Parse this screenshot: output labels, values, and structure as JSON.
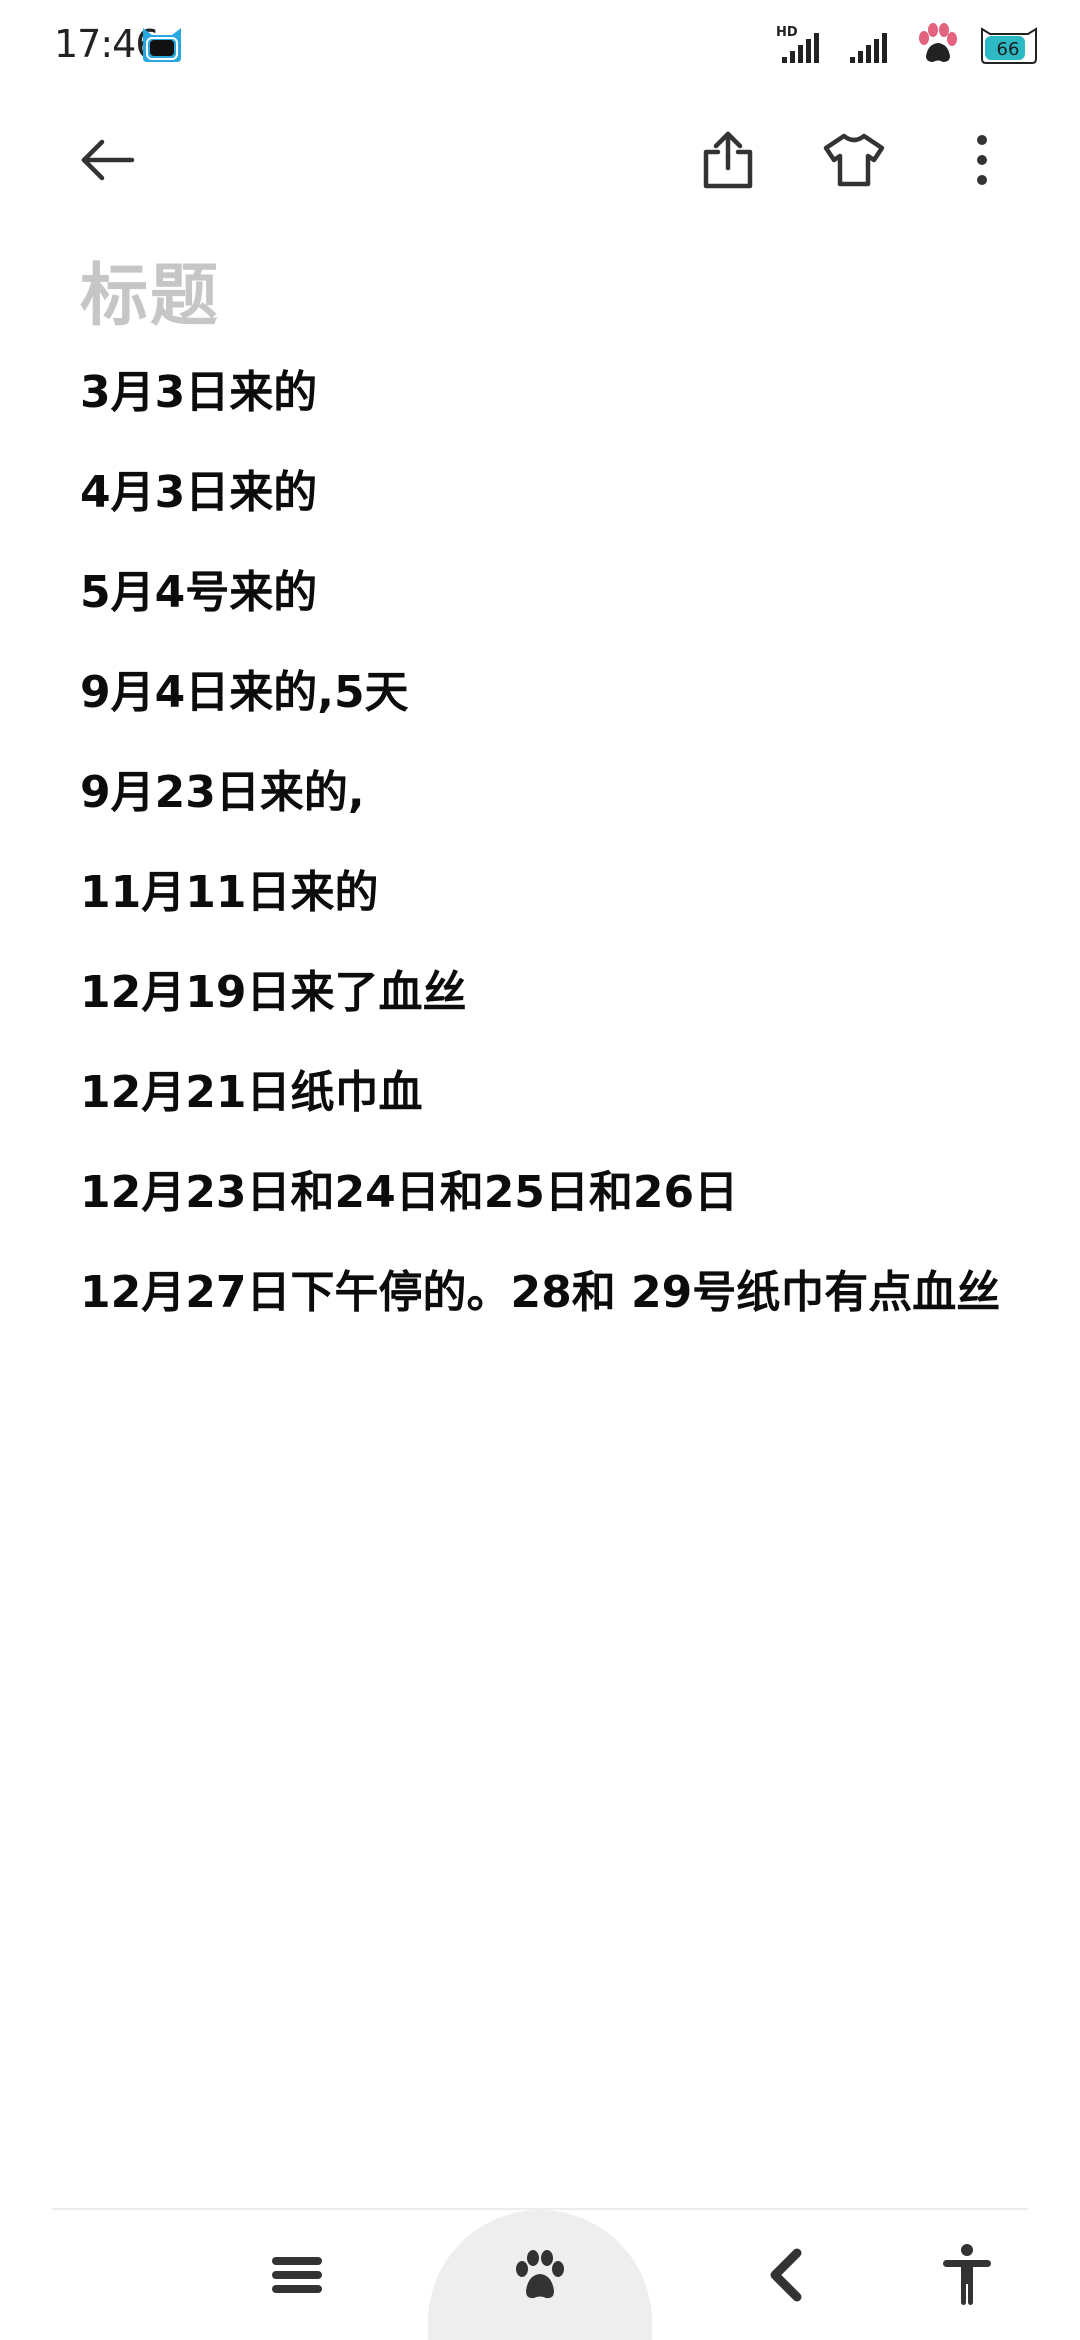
{
  "status_bar": {
    "time": "17:46",
    "network_label": "HD",
    "battery_level": "66"
  },
  "toolbar": {
    "back_icon": "arrow-left-icon",
    "share_icon": "share-icon",
    "theme_icon": "tshirt-icon",
    "more_icon": "more-vertical-icon"
  },
  "note": {
    "title_placeholder": "标题",
    "lines": [
      "3月3日来的",
      "4月3日来的",
      "5月4号来的",
      "9月4日来的,5天",
      "9月23日来的,",
      "11月11日来的",
      "12月19日来了血丝",
      "12月21日纸巾血",
      "12月23日和24日和25日和26日",
      "12月27日下午停的。28和 29号纸巾有点血丝"
    ]
  },
  "nav_bar": {
    "menu_icon": "menu-icon",
    "home_icon": "paw-icon",
    "back_icon": "chevron-left-icon",
    "accessibility_icon": "accessibility-icon"
  }
}
